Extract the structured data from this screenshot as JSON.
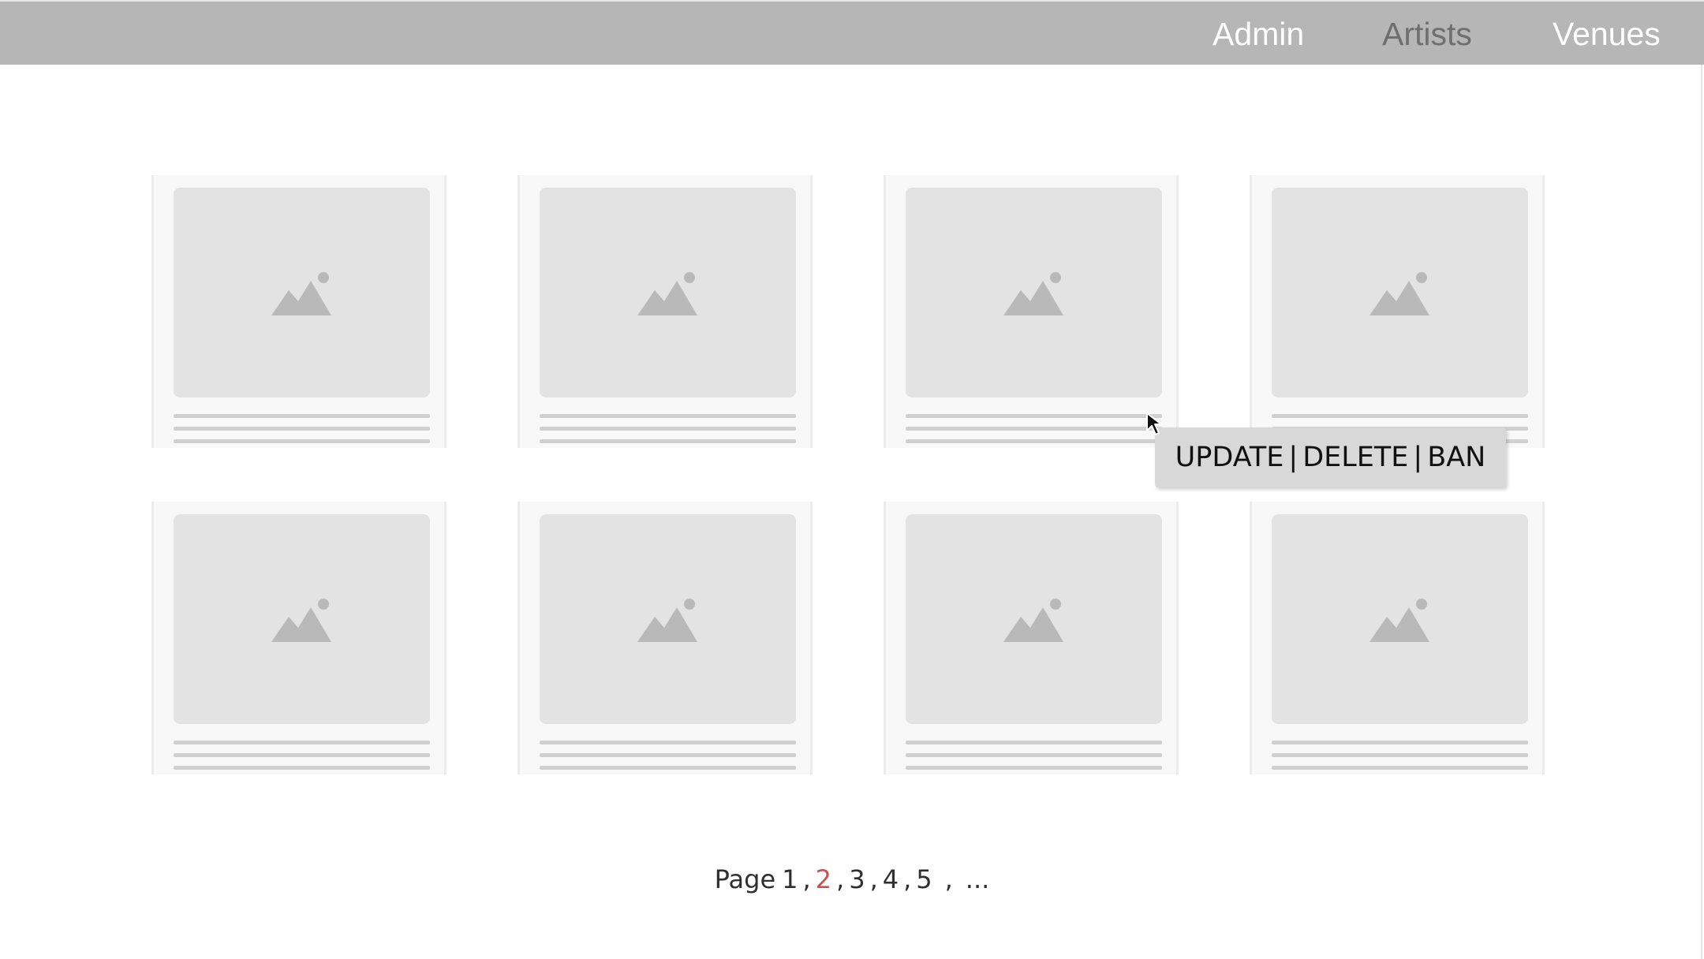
{
  "nav": {
    "items": [
      {
        "label": "Admin"
      },
      {
        "label": "Artists"
      },
      {
        "label": "Venues"
      }
    ]
  },
  "cards": [
    {
      "image_icon": "image-placeholder-icon"
    },
    {
      "image_icon": "image-placeholder-icon"
    },
    {
      "image_icon": "image-placeholder-icon"
    },
    {
      "image_icon": "image-placeholder-icon"
    },
    {
      "image_icon": "image-placeholder-icon"
    },
    {
      "image_icon": "image-placeholder-icon"
    },
    {
      "image_icon": "image-placeholder-icon"
    },
    {
      "image_icon": "image-placeholder-icon"
    }
  ],
  "popup": {
    "update_label": "UPDATE",
    "delete_label": "DELETE",
    "ban_label": "BAN",
    "separator": "|"
  },
  "pagination": {
    "label": "Page",
    "pages": [
      "1",
      "2",
      "3",
      "4",
      "5"
    ],
    "current_page": "2",
    "more": "..."
  },
  "colors": {
    "navbar": "#b6b6b6",
    "nav_active": "#ffffff",
    "nav_muted": "#6f6f6f",
    "current_page": "#c9524e",
    "card_background": "#f8f8f8",
    "thumb_background": "#e3e3e3",
    "popup_background": "#d8d8d8"
  }
}
